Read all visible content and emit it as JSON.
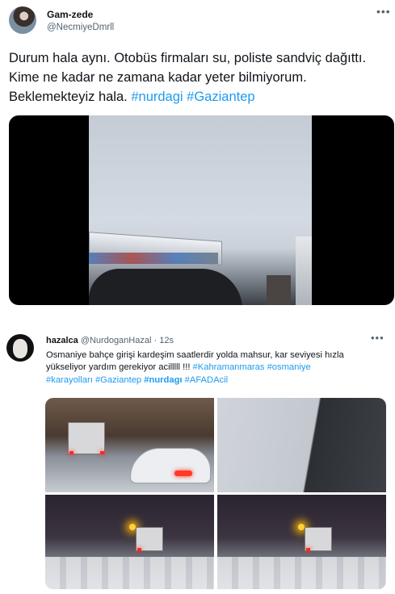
{
  "tweet1": {
    "display_name": "Gam-zede",
    "handle": "@NecmiyeDmrll",
    "more_icon": "more-dots-icon",
    "text_plain": "Durum hala aynı. Otobüs firmaları su, poliste sandviç dağıttı. Kime ne kadar ne zamana kadar yeter bilmiyorum. Beklemekteyiz hala.",
    "hashtags": [
      "#nurdagi",
      "#Gaziantep"
    ]
  },
  "tweet2": {
    "display_name": "hazalca",
    "handle": "@NurdoganHazal",
    "time": "· 12s",
    "more_icon": "more-dots-icon",
    "text_line1": "Osmaniye bahçe girişi kardeşim saatlerdir yolda mahsur, kar seviyesi hızla",
    "text_line2": "yükseliyor yardım gerekiyor acilllll !!!",
    "hashtags_line2": [
      "#Kahramanmaras",
      "#osmaniye"
    ],
    "hashtags_line3": [
      "#karayolları",
      "#Gaziantep",
      "#nurdagı",
      "#AFADAcil"
    ]
  },
  "colors": {
    "text": "#0f1419",
    "secondary": "#536471",
    "link": "#1d9bf0"
  }
}
